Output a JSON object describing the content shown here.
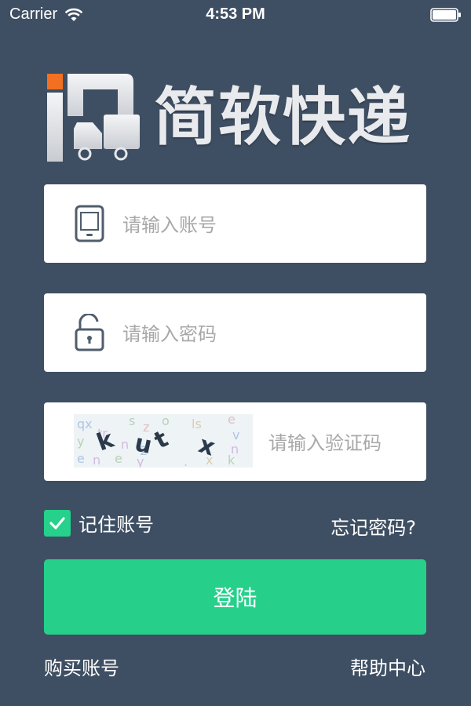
{
  "status_bar": {
    "carrier": "Carrier",
    "time": "4:53 PM"
  },
  "logo": {
    "brand_name": "简软快递",
    "accent_color": "#f36f21"
  },
  "form": {
    "account_placeholder": "请输入账号",
    "password_placeholder": "请输入密码",
    "captcha_placeholder": "请输入验证码",
    "remember_label": "记住账号",
    "remember_checked": true,
    "forgot_label": "忘记密码?",
    "login_label": "登陆"
  },
  "footer": {
    "buy_label": "购买账号",
    "help_label": "帮助中心"
  },
  "colors": {
    "background": "#3f4f63",
    "primary": "#26d08b"
  }
}
